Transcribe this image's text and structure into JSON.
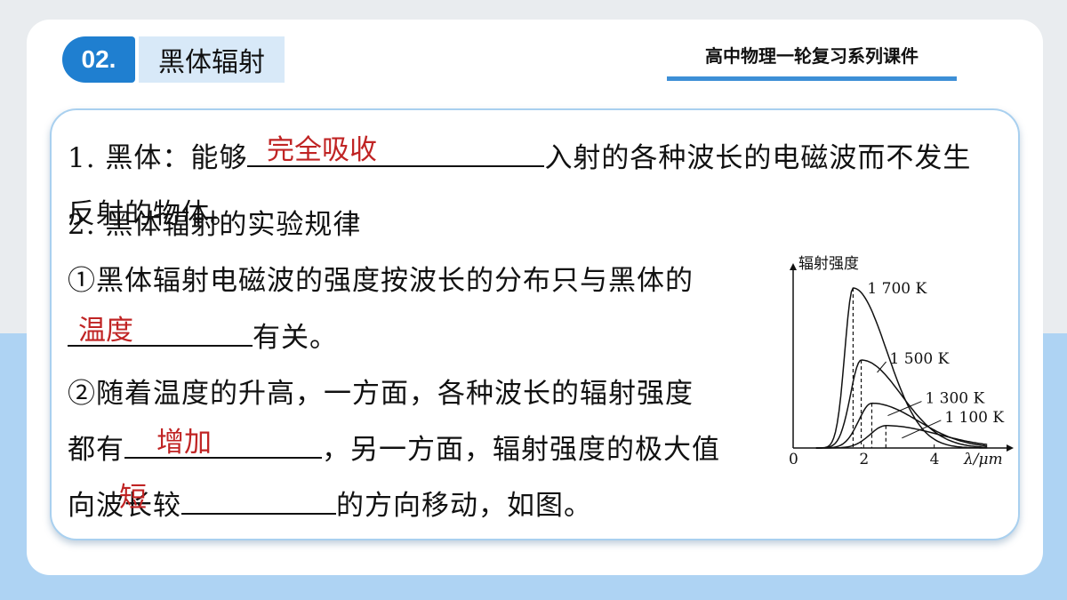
{
  "header": {
    "section_number": "02.",
    "section_title": "黑体辐射",
    "series_title": "高中物理一轮复习系列课件"
  },
  "content": {
    "line1_prefix": "1. 黑体：能够",
    "line1_suffix": "入射的各种波长的电磁波而不发生",
    "line2": "反射的物体。",
    "line3": "2. 黑体辐射的实验规律",
    "line4": "①黑体辐射电磁波的强度按波长的分布只与黑体的",
    "line5_suffix": "有关。",
    "line6": "②随着温度的升高，一方面，各种波长的辐射强度",
    "line7_prefix": "都有",
    "line7_suffix": "，另一方面，辐射强度的极大值",
    "line8_prefix": "向波长较",
    "line8_suffix": "的方向移动，如图。"
  },
  "answers": {
    "a1": "完全吸收",
    "a2": "温度",
    "a3": "增加",
    "a4": "短"
  },
  "chart_data": {
    "type": "line",
    "ylabel": "辐射强度",
    "xlabel": "λ/μm",
    "x_ticks": [
      "0",
      "2",
      "4"
    ],
    "xlim": [
      0,
      6
    ],
    "series": [
      {
        "name": "1 700 K",
        "peak_x": 1.7,
        "peak": 1.0
      },
      {
        "name": "1 500 K",
        "peak_x": 1.93,
        "peak": 0.55
      },
      {
        "name": "1 300 K",
        "peak_x": 2.23,
        "peak": 0.28
      },
      {
        "name": "1 100 K",
        "peak_x": 2.63,
        "peak": 0.14
      }
    ]
  }
}
